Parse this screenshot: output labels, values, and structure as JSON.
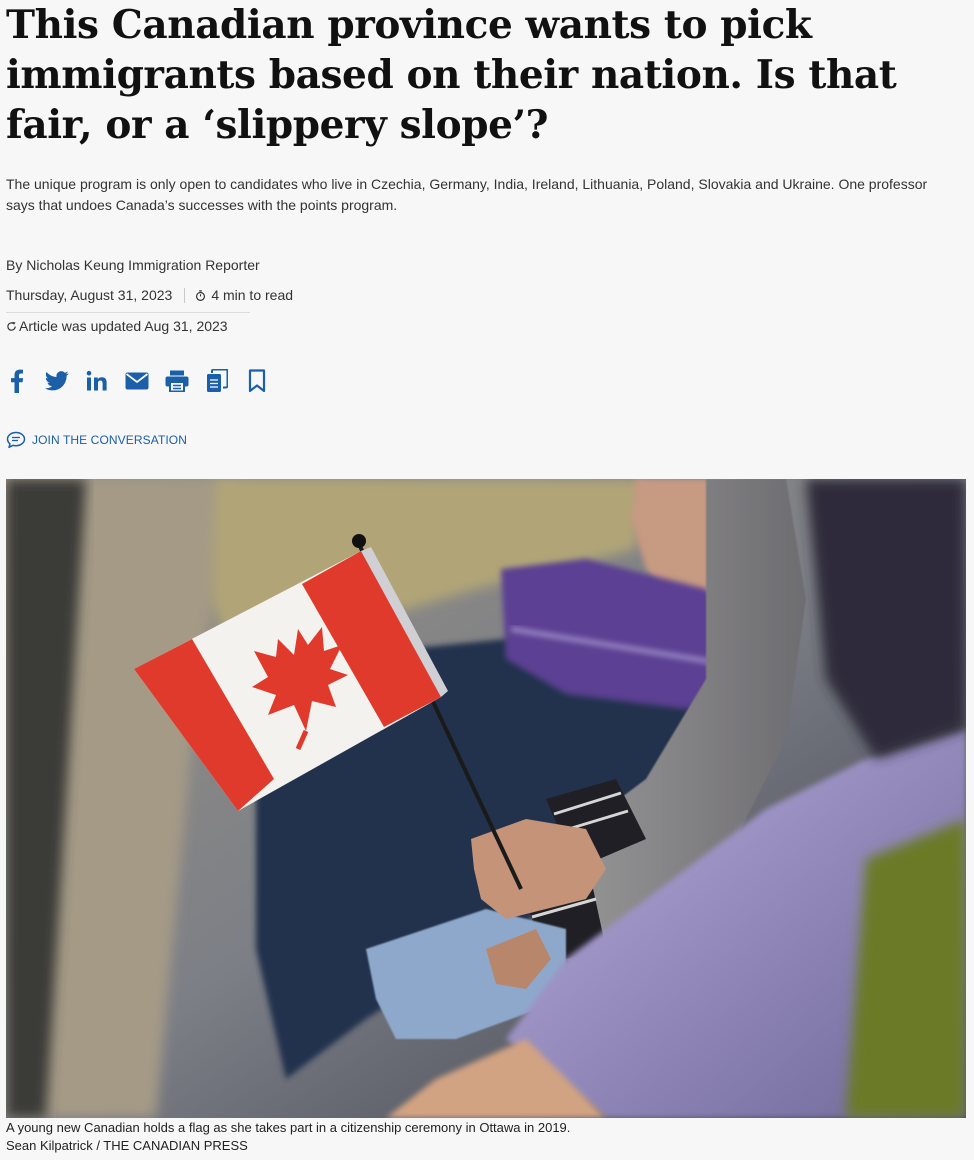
{
  "article": {
    "headline": "This Canadian province wants to pick immigrants based on their nation. Is that fair, or a ‘slippery slope’?",
    "dek": "The unique program is only open to candidates who live in Czechia, Germany, India, Ireland, Lithuania, Poland, Slovakia and Ukraine. One professor says that undoes Canada’s successes with the points program.",
    "byline": "By Nicholas Keung Immigration Reporter",
    "date": "Thursday, August 31, 2023",
    "read_time": "4 min to read",
    "updated": "Article was updated Aug 31, 2023"
  },
  "share": {
    "icons": [
      "facebook-icon",
      "twitter-icon",
      "linkedin-icon",
      "email-icon",
      "print-icon",
      "copy-icon",
      "bookmark-icon"
    ],
    "color": "#1a5fa8"
  },
  "conversation": {
    "label": "JOIN THE CONVERSATION",
    "icon": "comment-icon"
  },
  "photo": {
    "caption": "A young new Canadian holds a flag as she takes part in a citizenship ceremony in Ottawa in 2019.",
    "credit": "Sean Kilpatrick / THE CANADIAN PRESS"
  },
  "colors": {
    "accent": "#1a5fa8",
    "flag_red": "#e03a2c",
    "background": "#f7f7f7"
  }
}
